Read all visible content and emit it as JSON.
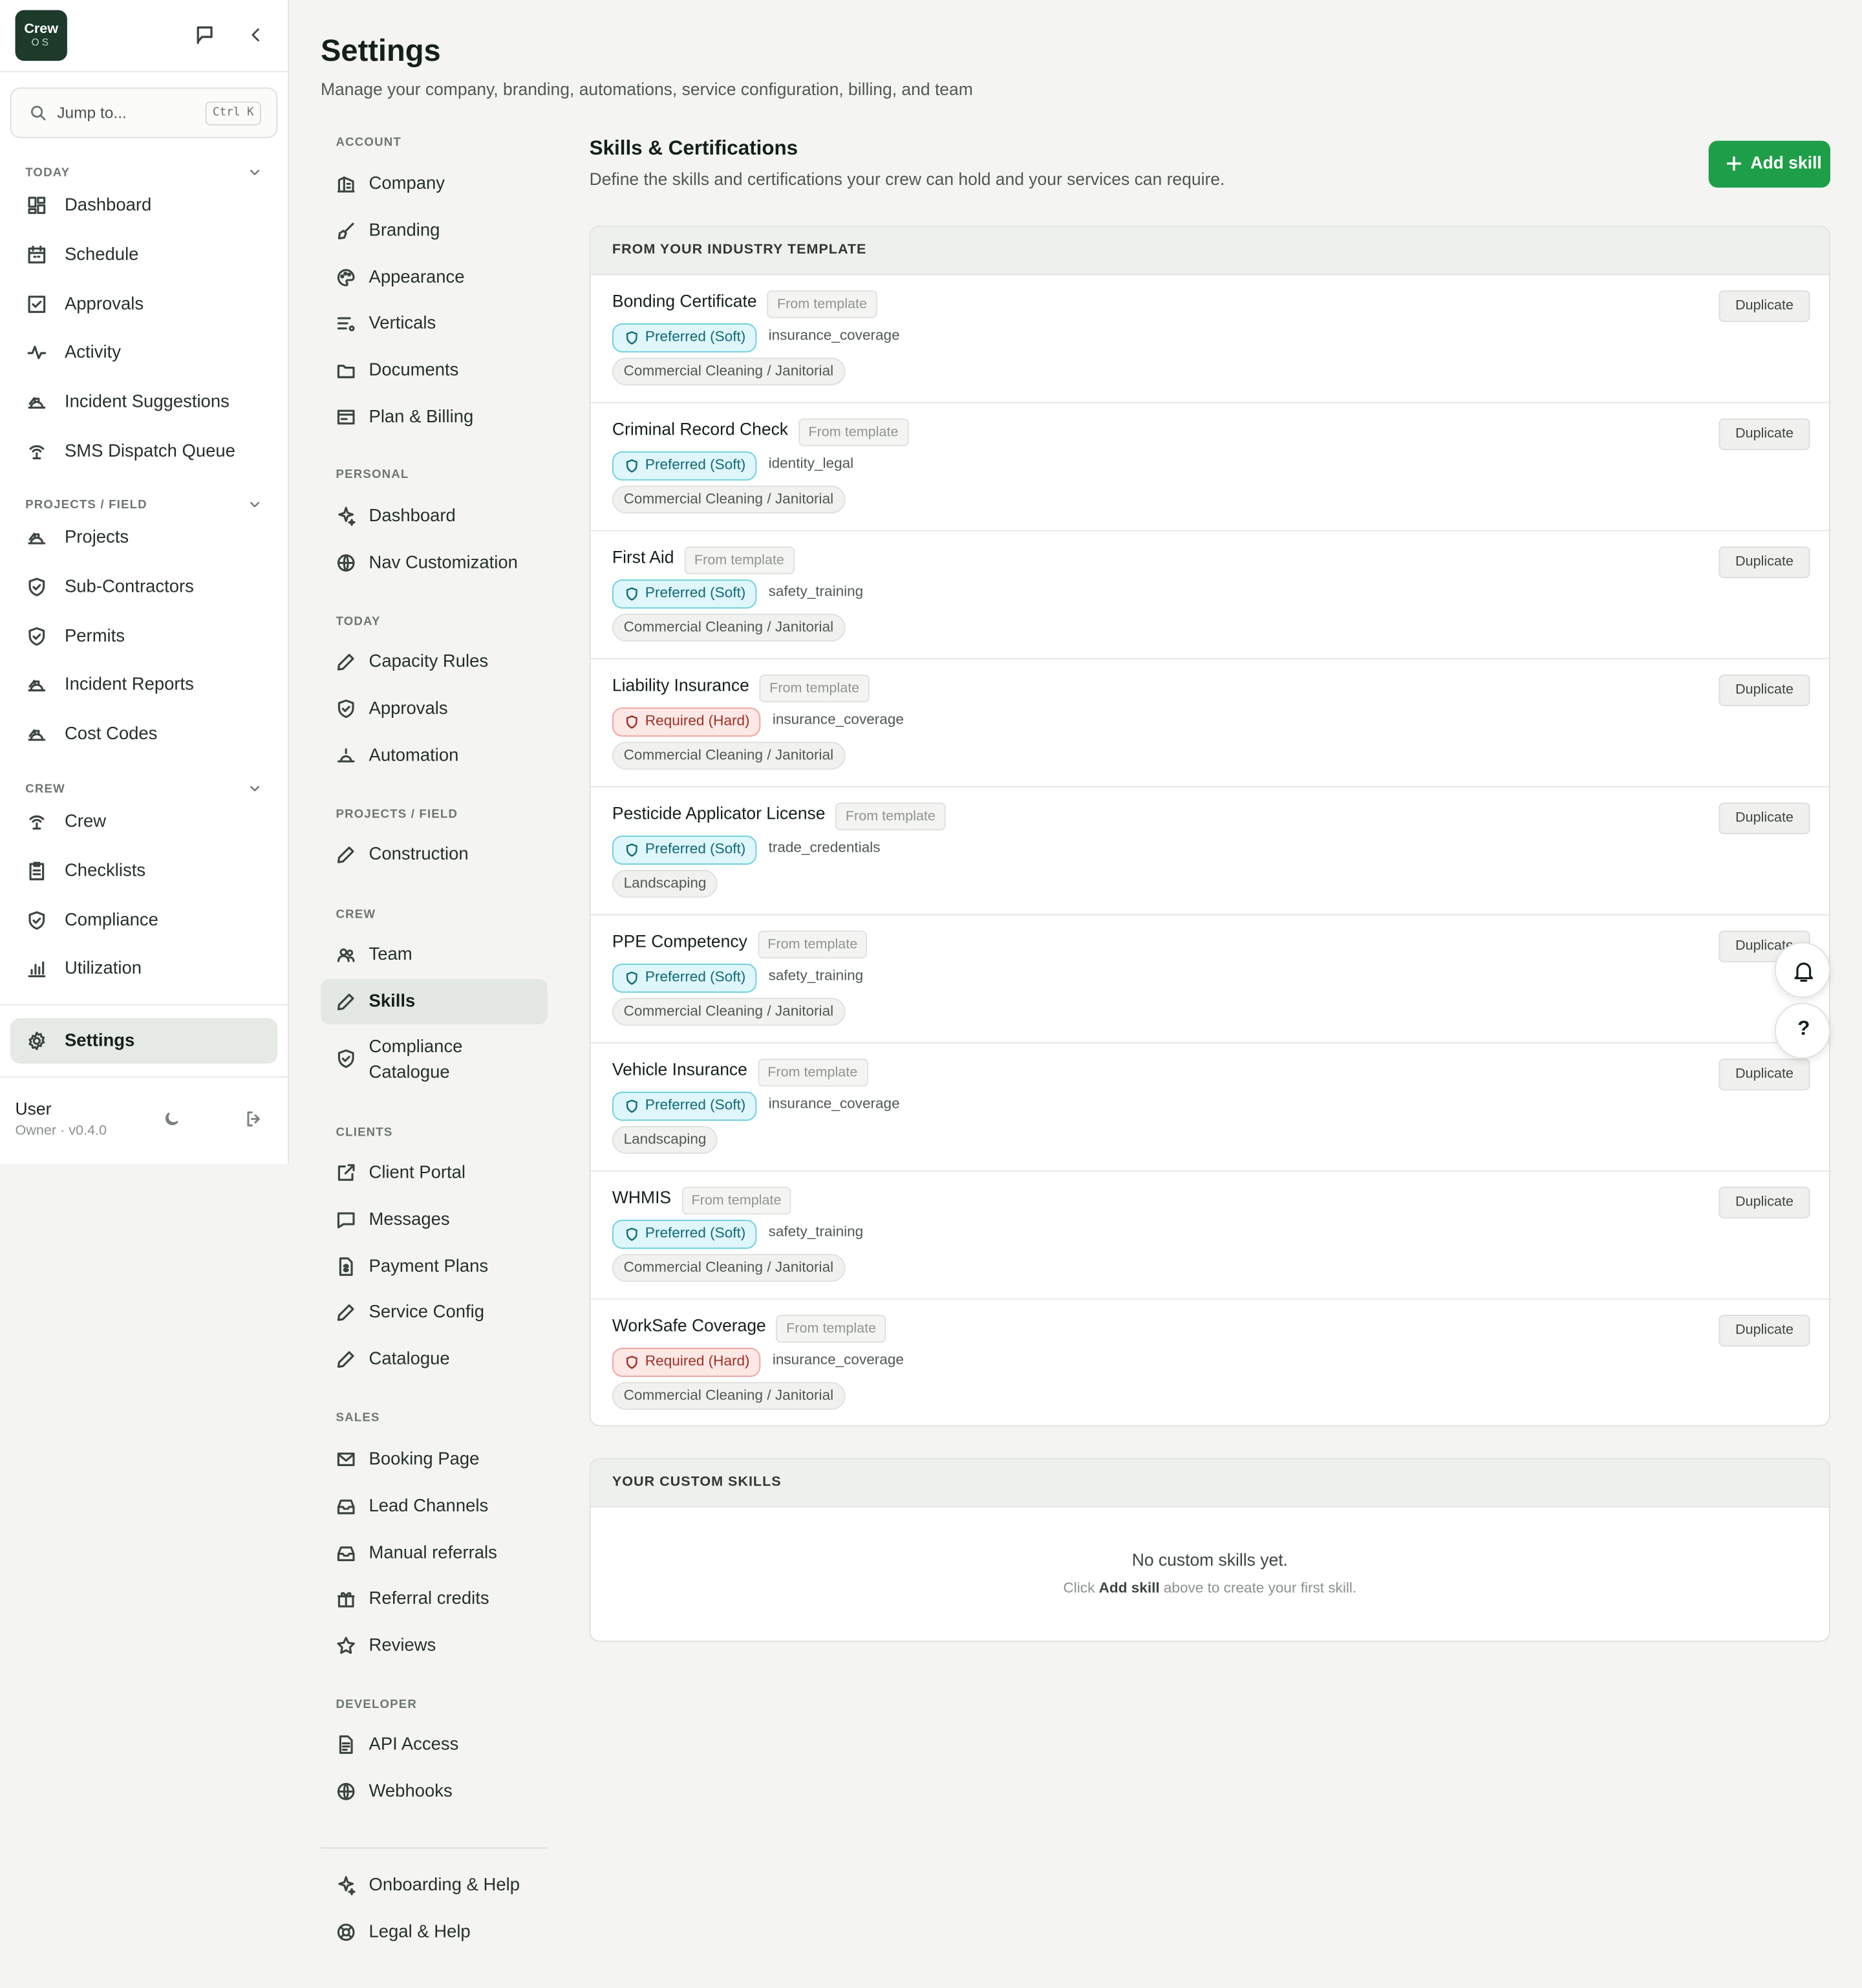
{
  "app": {
    "logo_line1": "Crew",
    "logo_line2": "OS"
  },
  "search": {
    "placeholder": "Jump to...",
    "shortcut": "Ctrl K"
  },
  "sidebar": {
    "sections": [
      {
        "label": "TODAY",
        "items": [
          {
            "label": "Dashboard",
            "icon": "dashboard-icon"
          },
          {
            "label": "Schedule",
            "icon": "calendar-icon"
          },
          {
            "label": "Approvals",
            "icon": "check-square-icon"
          },
          {
            "label": "Activity",
            "icon": "activity-icon"
          },
          {
            "label": "Incident Suggestions",
            "icon": "hardhat-icon"
          },
          {
            "label": "SMS Dispatch Queue",
            "icon": "broadcast-icon"
          }
        ]
      },
      {
        "label": "PROJECTS / FIELD",
        "items": [
          {
            "label": "Projects",
            "icon": "hardhat-icon"
          },
          {
            "label": "Sub-Contractors",
            "icon": "shield-check-icon"
          },
          {
            "label": "Permits",
            "icon": "shield-check-icon"
          },
          {
            "label": "Incident Reports",
            "icon": "hardhat-icon"
          },
          {
            "label": "Cost Codes",
            "icon": "hardhat-icon"
          }
        ]
      },
      {
        "label": "CREW",
        "items": [
          {
            "label": "Crew",
            "icon": "broadcast-icon"
          },
          {
            "label": "Checklists",
            "icon": "clipboard-icon"
          },
          {
            "label": "Compliance",
            "icon": "shield-check-icon"
          },
          {
            "label": "Utilization",
            "icon": "bar-chart-icon"
          }
        ]
      }
    ],
    "settings_label": "Settings",
    "user": {
      "name": "User",
      "role": "Owner · v0.4.0"
    }
  },
  "page": {
    "title": "Settings",
    "subtitle": "Manage your company, branding, automations, service configuration, billing, and team"
  },
  "settings_nav": {
    "account": {
      "label": "ACCOUNT",
      "items": [
        "Company",
        "Branding",
        "Appearance",
        "Verticals",
        "Documents",
        "Plan & Billing"
      ]
    },
    "personal": {
      "label": "PERSONAL",
      "items": [
        "Dashboard",
        "Nav Customization"
      ]
    },
    "today": {
      "label": "TODAY",
      "items": [
        "Capacity Rules",
        "Approvals",
        "Automation"
      ]
    },
    "projects": {
      "label": "PROJECTS / FIELD",
      "items": [
        "Construction"
      ]
    },
    "crew": {
      "label": "CREW",
      "items": [
        "Team",
        "Skills",
        "Compliance Catalogue"
      ]
    },
    "clients": {
      "label": "CLIENTS",
      "items": [
        "Client Portal",
        "Messages",
        "Payment Plans",
        "Service Config",
        "Catalogue"
      ]
    },
    "sales": {
      "label": "SALES",
      "items": [
        "Booking Page",
        "Lead Channels",
        "Manual referrals",
        "Referral credits",
        "Reviews"
      ]
    },
    "developer": {
      "label": "DEVELOPER",
      "items": [
        "API Access",
        "Webhooks"
      ]
    },
    "footer": {
      "items": [
        "Onboarding & Help",
        "Legal & Help"
      ]
    }
  },
  "skills": {
    "title": "Skills & Certifications",
    "subtitle": "Define the skills and certifications your crew can hold and your services can require.",
    "add_label": "Add skill",
    "template_header": "FROM YOUR INDUSTRY TEMPLATE",
    "template_tag": "From template",
    "duplicate_label": "Duplicate",
    "rows": [
      {
        "name": "Bonding Certificate",
        "requirement": "Preferred (Soft)",
        "level": "soft",
        "category": "insurance_coverage",
        "vertical": "Commercial Cleaning / Janitorial"
      },
      {
        "name": "Criminal Record Check",
        "requirement": "Preferred (Soft)",
        "level": "soft",
        "category": "identity_legal",
        "vertical": "Commercial Cleaning / Janitorial"
      },
      {
        "name": "First Aid",
        "requirement": "Preferred (Soft)",
        "level": "soft",
        "category": "safety_training",
        "vertical": "Commercial Cleaning / Janitorial"
      },
      {
        "name": "Liability Insurance",
        "requirement": "Required (Hard)",
        "level": "hard",
        "category": "insurance_coverage",
        "vertical": "Commercial Cleaning / Janitorial"
      },
      {
        "name": "Pesticide Applicator License",
        "requirement": "Preferred (Soft)",
        "level": "soft",
        "category": "trade_credentials",
        "vertical": "Landscaping"
      },
      {
        "name": "PPE Competency",
        "requirement": "Preferred (Soft)",
        "level": "soft",
        "category": "safety_training",
        "vertical": "Commercial Cleaning / Janitorial"
      },
      {
        "name": "Vehicle Insurance",
        "requirement": "Preferred (Soft)",
        "level": "soft",
        "category": "insurance_coverage",
        "vertical": "Landscaping"
      },
      {
        "name": "WHMIS",
        "requirement": "Preferred (Soft)",
        "level": "soft",
        "category": "safety_training",
        "vertical": "Commercial Cleaning / Janitorial"
      },
      {
        "name": "WorkSafe Coverage",
        "requirement": "Required (Hard)",
        "level": "hard",
        "category": "insurance_coverage",
        "vertical": "Commercial Cleaning / Janitorial"
      }
    ],
    "custom_header": "YOUR CUSTOM SKILLS",
    "empty_title": "No custom skills yet.",
    "empty_pre": "Click ",
    "empty_bold": "Add skill",
    "empty_post": " above to create your first skill."
  },
  "colors": {
    "brand": "#1d3a2a",
    "primary_button": "#1e9e48",
    "soft_badge": "#dff6fa",
    "hard_badge": "#fde8e6"
  }
}
